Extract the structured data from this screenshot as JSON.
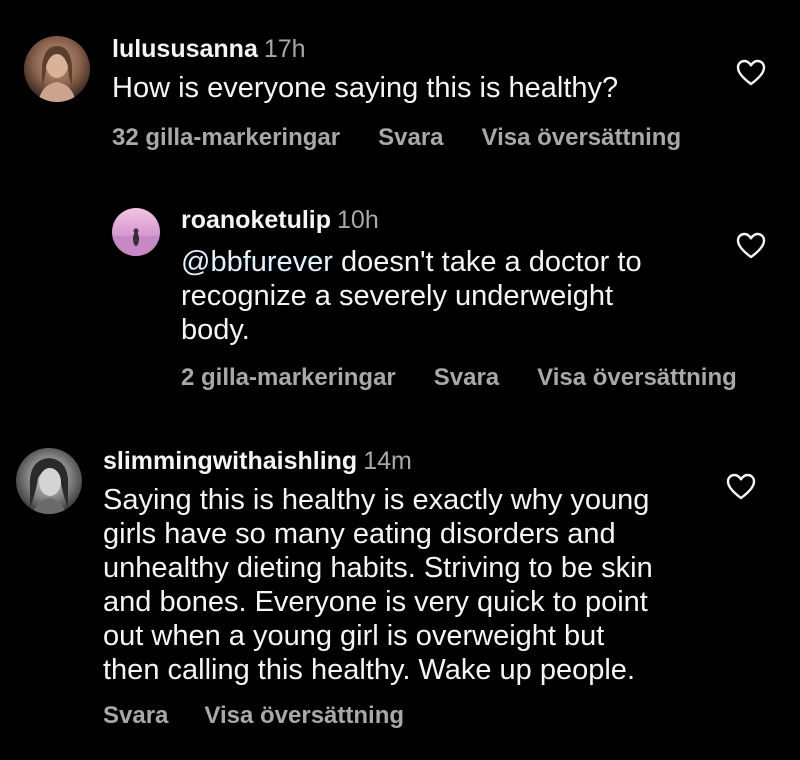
{
  "colors": {
    "background": "#000000",
    "text_primary": "#f5f5f5",
    "text_secondary": "#a8a8a8"
  },
  "comments": [
    {
      "username": "lulususanna",
      "time": "17h",
      "text": "How is everyone saying this is healthy?",
      "likes": "32 gilla-markeringar",
      "reply": "Svara",
      "translate": "Visa översättning",
      "icon": "heart-icon"
    },
    {
      "username": "roanoketulip",
      "time": "10h",
      "mention": "@bbfurever",
      "text_line1": " doesn't take a doctor to",
      "text_line2": "recognize a severely underweight",
      "text_line3": "body.",
      "likes": "2 gilla-markeringar",
      "reply": "Svara",
      "translate": "Visa översättning",
      "icon": "heart-icon"
    },
    {
      "username": "slimmingwithaishling",
      "time": "14m",
      "lines": [
        "Saying this is healthy is exactly why young",
        "girls have so many eating disorders and",
        "unhealthy dieting habits. Striving to be skin",
        "and bones. Everyone is very quick to point",
        "out when a young girl is overweight but",
        "then calling this healthy. Wake up people."
      ],
      "reply": "Svara",
      "translate": "Visa översättning",
      "icon": "heart-icon"
    }
  ]
}
